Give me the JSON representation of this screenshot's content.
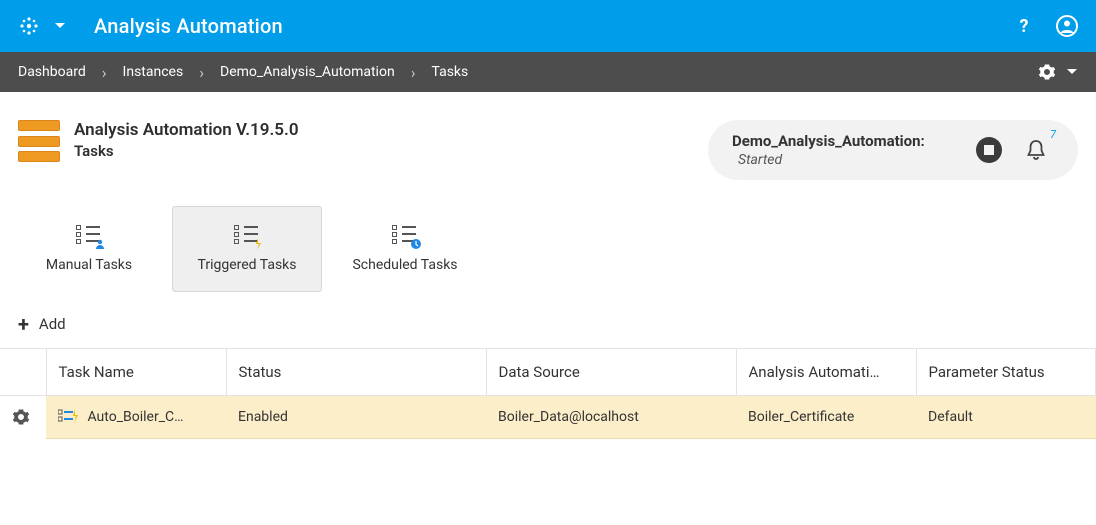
{
  "header": {
    "title": "Analysis Automation"
  },
  "breadcrumbs": {
    "items": [
      "Dashboard",
      "Instances",
      "Demo_Analysis_Automation",
      "Tasks"
    ]
  },
  "page": {
    "product": "Analysis Automation V.19.5.0",
    "section": "Tasks"
  },
  "instance_status": {
    "name": "Demo_Analysis_Automation:",
    "state": "Started",
    "notifications": "7"
  },
  "tabs": [
    {
      "label": "Manual Tasks",
      "active": false
    },
    {
      "label": "Triggered Tasks",
      "active": true
    },
    {
      "label": "Scheduled Tasks",
      "active": false
    }
  ],
  "actions": {
    "add_label": "Add"
  },
  "table": {
    "columns": [
      "Task Name",
      "Status",
      "Data Source",
      "Analysis Automati…",
      "Parameter Status"
    ],
    "rows": [
      {
        "task_name": "Auto_Boiler_C…",
        "status": "Enabled",
        "data_source": "Boiler_Data@localhost",
        "automation": "Boiler_Certificate",
        "param_status": "Default"
      }
    ]
  }
}
